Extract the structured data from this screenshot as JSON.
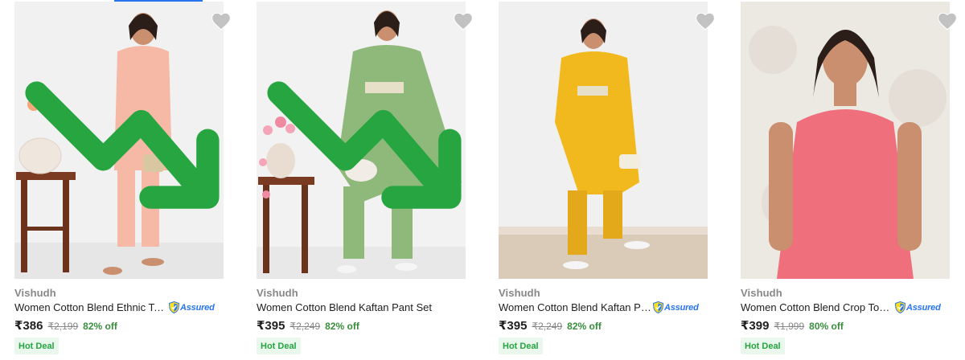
{
  "colors": {
    "accent": "#2874f0",
    "discount": "#388e3c",
    "deal_bg": "#e9f7ec",
    "deal_text": "#26a541",
    "muted": "#878787",
    "wishlist": "#c2c2c2"
  },
  "products": [
    {
      "brand": "Vishudh",
      "title": "Women Cotton Blend Ethnic Top ...",
      "assured": "Assured",
      "price": "₹386",
      "mrp": "₹2,199",
      "discount": "82% off",
      "deal": "Hot Deal",
      "trend_icon": "trending-down-icon",
      "outfit_color": "#f6b9a6"
    },
    {
      "brand": "Vishudh",
      "title": "Women Cotton Blend Kaftan Pant Set",
      "assured": "",
      "price": "₹395",
      "mrp": "₹2,249",
      "discount": "82% off",
      "deal": "Hot Deal",
      "trend_icon": "trending-down-icon",
      "outfit_color": "#8fb97a"
    },
    {
      "brand": "Vishudh",
      "title": "Women Cotton Blend Kaftan Pan...",
      "assured": "Assured",
      "price": "₹395",
      "mrp": "₹2,249",
      "discount": "82% off",
      "deal": "Hot Deal",
      "trend_icon": "",
      "outfit_color": "#f2b91f"
    },
    {
      "brand": "Vishudh",
      "title": "Women Cotton Blend Crop Top ...",
      "assured": "Assured",
      "price": "₹399",
      "mrp": "₹1,999",
      "discount": "80% off",
      "deal": "Hot Deal",
      "trend_icon": "",
      "outfit_color": "#ef6f7c"
    }
  ]
}
